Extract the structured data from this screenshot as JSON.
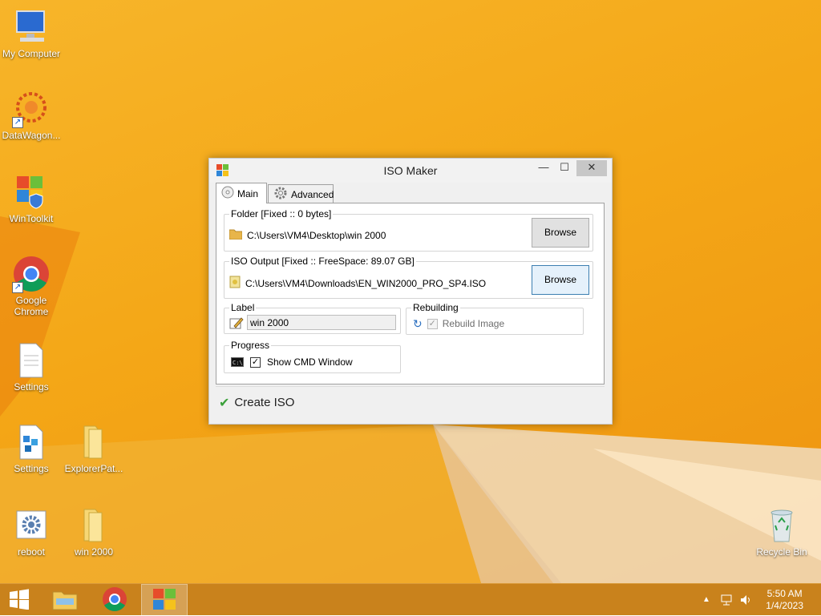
{
  "desktop": {
    "icons": [
      {
        "label": "My Computer"
      },
      {
        "label": "DataWagon..."
      },
      {
        "label": "WinToolkit"
      },
      {
        "label": "Google\nChrome"
      },
      {
        "label": "Settings"
      },
      {
        "label": "Settings"
      },
      {
        "label": "ExplorerPat..."
      },
      {
        "label": "reboot"
      },
      {
        "label": "win 2000"
      },
      {
        "label": "Recycle Bin"
      }
    ]
  },
  "window": {
    "title": "ISO Maker",
    "tabs": [
      {
        "label": "Main"
      },
      {
        "label": "Advanced"
      }
    ],
    "folder": {
      "title": "Folder [Fixed :: 0 bytes]",
      "path": "C:\\Users\\VM4\\Desktop\\win 2000",
      "browse_label": "Browse"
    },
    "iso_output": {
      "title": "ISO Output [Fixed :: FreeSpace: 89.07 GB]",
      "path": "C:\\Users\\VM4\\Downloads\\EN_WIN2000_PRO_SP4.ISO",
      "browse_label": "Browse"
    },
    "label_group": {
      "title": "Label",
      "value": "win 2000"
    },
    "rebuilding": {
      "title": "Rebuilding",
      "checkbox_label": "Rebuild Image"
    },
    "progress": {
      "title": "Progress",
      "checkbox_label": "Show CMD Window"
    },
    "create_label": "Create ISO"
  },
  "taskbar": {
    "time": "5:50 AM",
    "date": "1/4/2023"
  },
  "colors": {
    "desktop_accent": "#f4a717",
    "taskbar": "#c9821c"
  }
}
